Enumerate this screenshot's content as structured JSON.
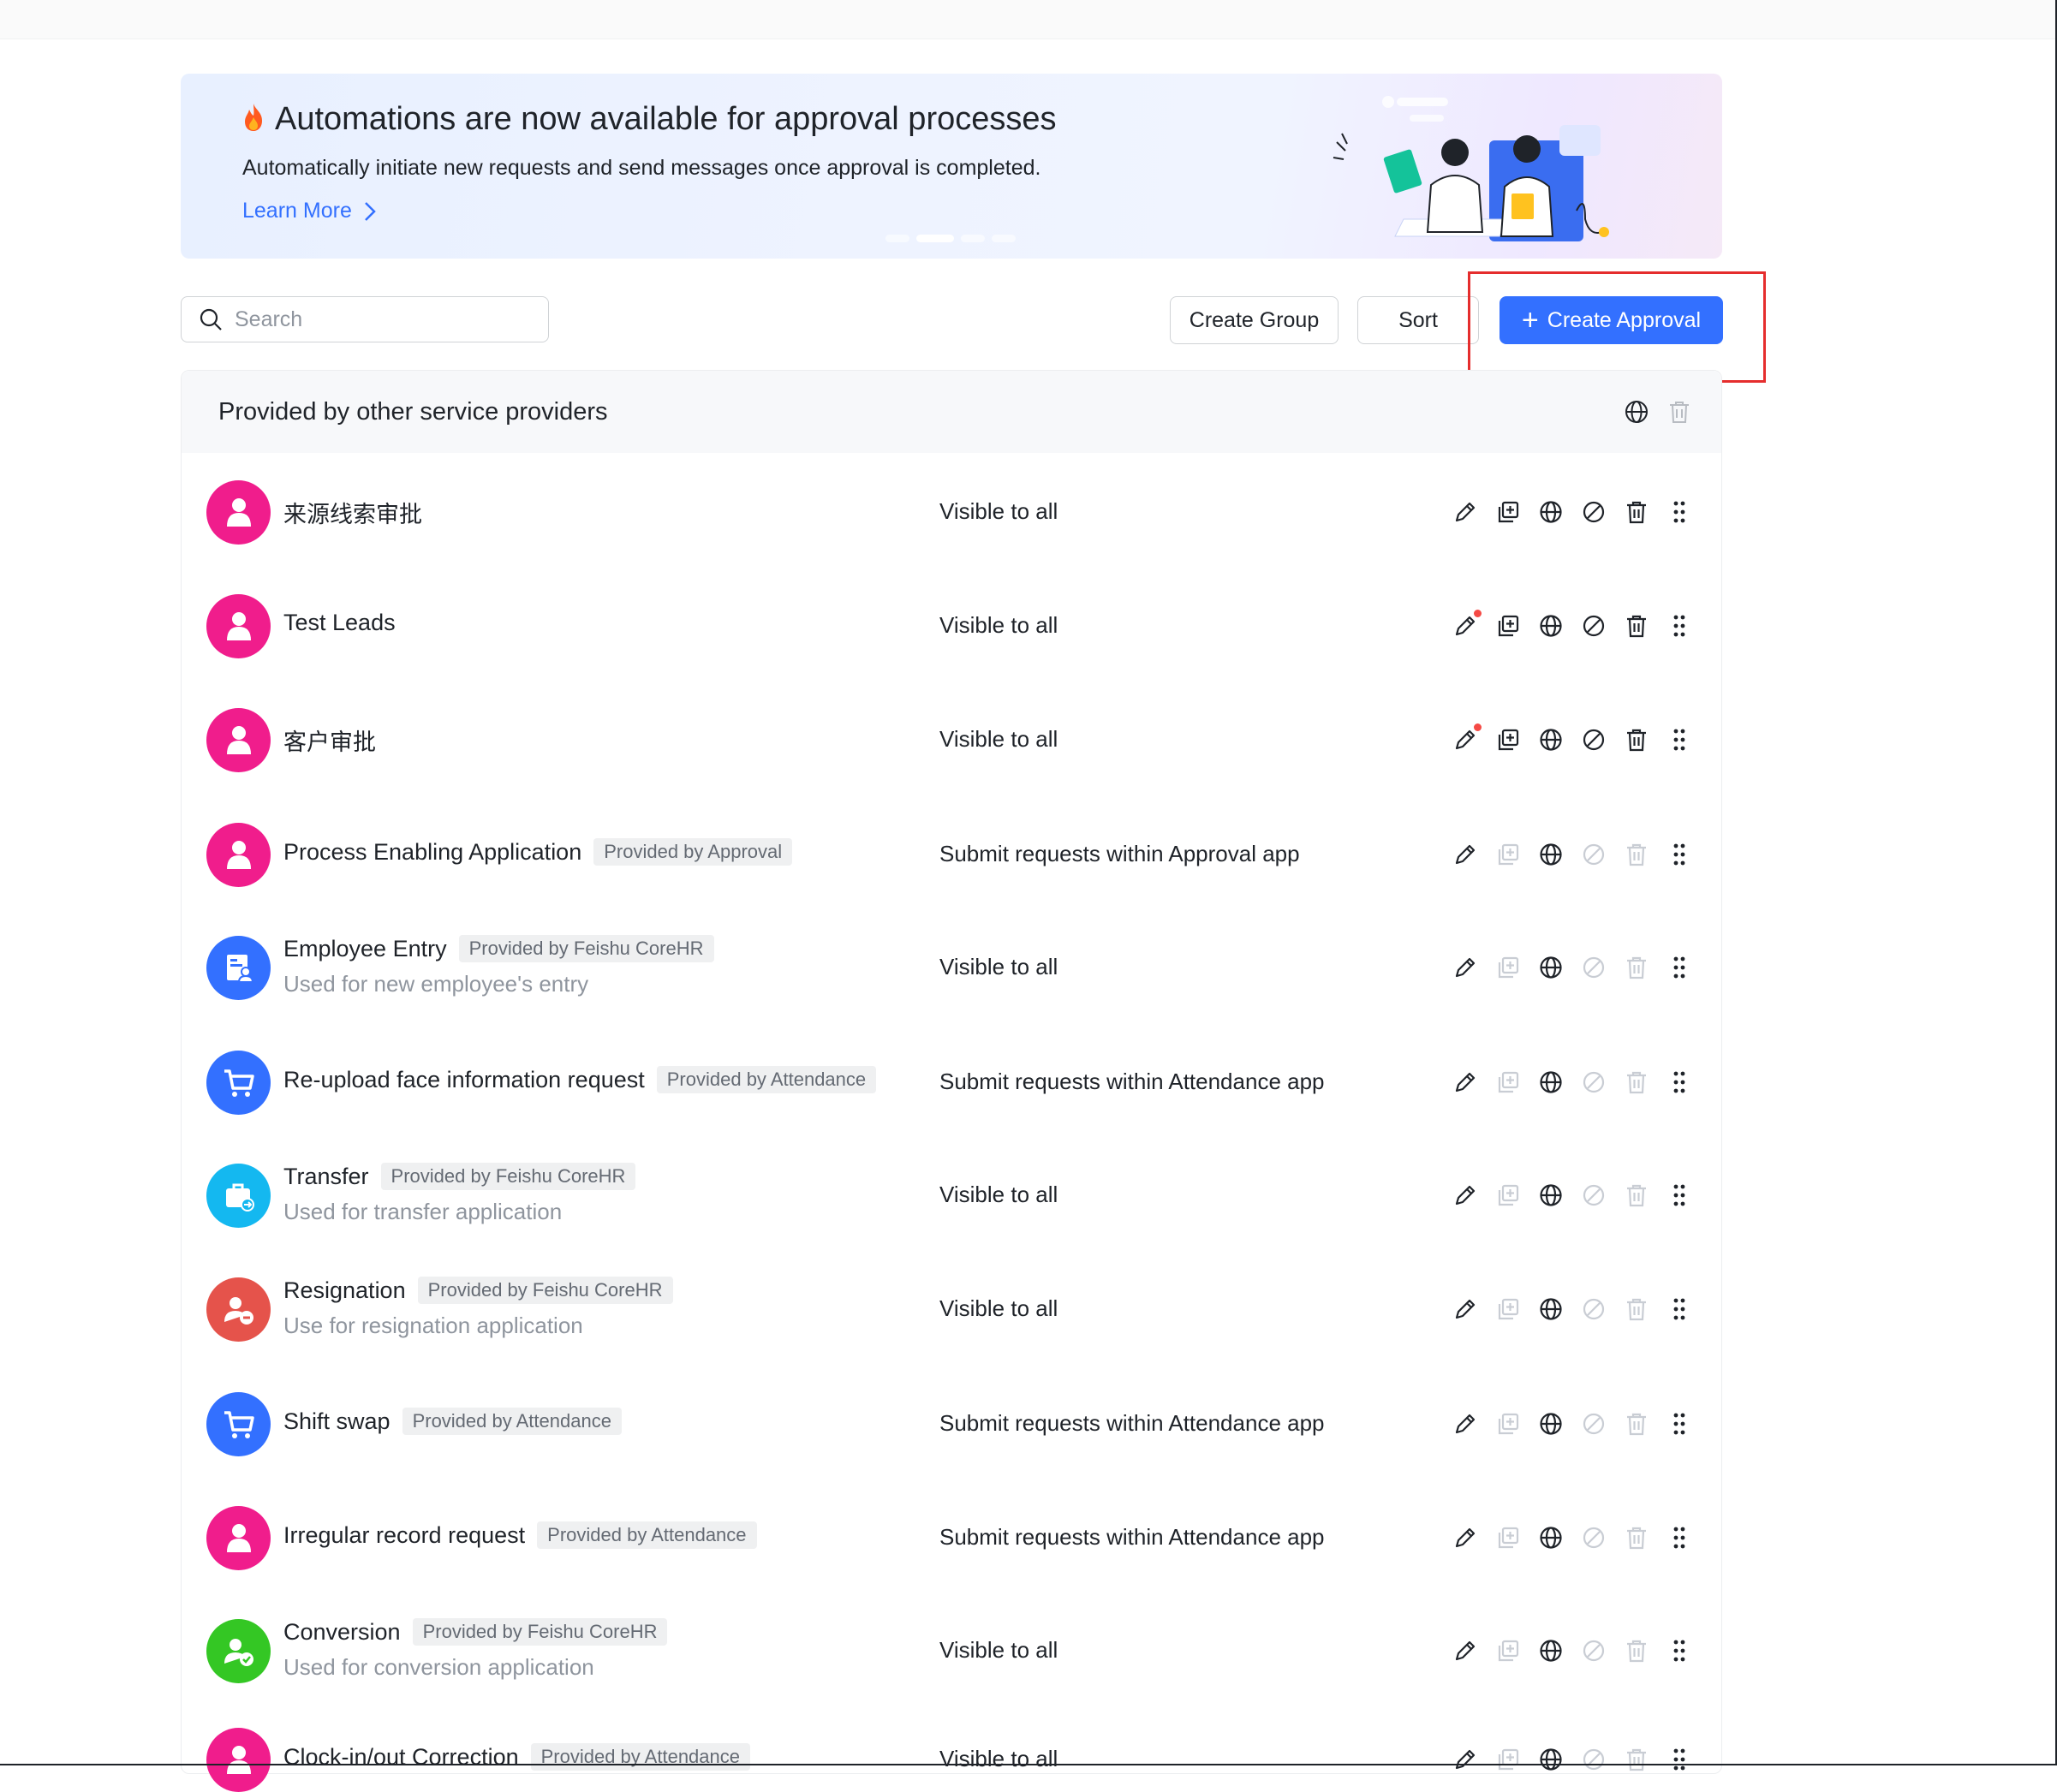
{
  "banner": {
    "title": "Automations are now available for approval processes",
    "subtitle": "Automatically initiate new requests and send messages once approval is completed.",
    "learn_more": "Learn More",
    "fire_icon": "fire-icon"
  },
  "toolbar": {
    "search_placeholder": "Search",
    "create_group": "Create Group",
    "sort": "Sort",
    "create_approval": "Create Approval"
  },
  "colors": {
    "primary": "#3370ff",
    "highlight": "#e52d2d",
    "pink_avatar": "#f01d8c",
    "blue_avatar": "#3370ff",
    "cyan_avatar": "#14b8f0",
    "red_avatar": "#e5534b",
    "green_avatar": "#34c724"
  },
  "group": {
    "title": "Provided by other service providers",
    "rows": [
      {
        "name": "来源线索审批",
        "tag": "",
        "desc": "",
        "visibility": "Visible to all",
        "avatar": "person-icon",
        "avatar_color": "#f01d8c",
        "edit_dot": false,
        "full_actions": true
      },
      {
        "name": "Test Leads",
        "tag": "",
        "desc": "",
        "visibility": "Visible to all",
        "avatar": "person-icon",
        "avatar_color": "#f01d8c",
        "edit_dot": true,
        "full_actions": true
      },
      {
        "name": "客户审批",
        "tag": "",
        "desc": "",
        "visibility": "Visible to all",
        "avatar": "person-icon",
        "avatar_color": "#f01d8c",
        "edit_dot": true,
        "full_actions": true
      },
      {
        "name": "Process Enabling Application",
        "tag": "Provided by Approval",
        "desc": "",
        "visibility": "Submit requests within Approval app",
        "avatar": "person-icon",
        "avatar_color": "#f01d8c",
        "edit_dot": false,
        "full_actions": false
      },
      {
        "name": "Employee Entry",
        "tag": "Provided by Feishu CoreHR",
        "desc": "Used for new employee's entry",
        "visibility": "Visible to all",
        "avatar": "id-card-icon",
        "avatar_color": "#3370ff",
        "edit_dot": false,
        "full_actions": false
      },
      {
        "name": "Re-upload face information request",
        "tag": "Provided by Attendance",
        "desc": "",
        "visibility": "Submit requests within Attendance app",
        "avatar": "cart-icon",
        "avatar_color": "#3370ff",
        "edit_dot": false,
        "full_actions": false
      },
      {
        "name": "Transfer",
        "tag": "Provided by Feishu CoreHR",
        "desc": "Used for transfer application",
        "visibility": "Visible to all",
        "avatar": "briefcase-icon",
        "avatar_color": "#14b8f0",
        "edit_dot": false,
        "full_actions": false
      },
      {
        "name": "Resignation",
        "tag": "Provided by Feishu CoreHR",
        "desc": "Use for resignation application",
        "visibility": "Visible to all",
        "avatar": "person-minus-icon",
        "avatar_color": "#e5534b",
        "edit_dot": false,
        "full_actions": false
      },
      {
        "name": "Shift swap",
        "tag": "Provided by Attendance",
        "desc": "",
        "visibility": "Submit requests within Attendance app",
        "avatar": "cart-icon",
        "avatar_color": "#3370ff",
        "edit_dot": false,
        "full_actions": false
      },
      {
        "name": "Irregular record request",
        "tag": "Provided by Attendance",
        "desc": "",
        "visibility": "Submit requests within Attendance app",
        "avatar": "person-icon",
        "avatar_color": "#f01d8c",
        "edit_dot": false,
        "full_actions": false
      },
      {
        "name": "Conversion",
        "tag": "Provided by Feishu CoreHR",
        "desc": "Used for conversion application",
        "visibility": "Visible to all",
        "avatar": "person-check-icon",
        "avatar_color": "#34c724",
        "edit_dot": false,
        "full_actions": false
      },
      {
        "name": "Clock-in/out Correction",
        "tag": "Provided by Attendance",
        "desc": "",
        "visibility": "Visible to all",
        "avatar": "person-icon",
        "avatar_color": "#f01d8c",
        "edit_dot": false,
        "full_actions": false
      }
    ]
  }
}
